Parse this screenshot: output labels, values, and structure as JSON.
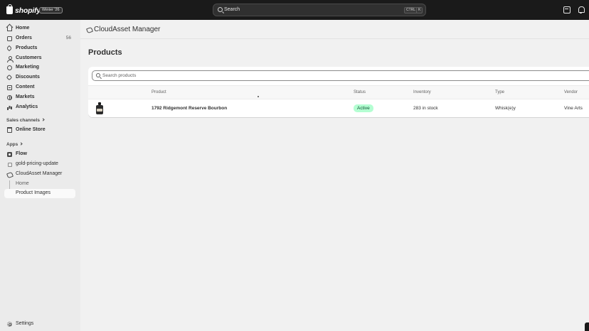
{
  "topbar": {
    "brand": "shopify",
    "edition": "Winter '26",
    "search_placeholder": "Search",
    "shortcut_ctrl": "CTRL",
    "shortcut_key": "K"
  },
  "sidebar": {
    "items": [
      {
        "label": "Home",
        "icon": "home-icon"
      },
      {
        "label": "Orders",
        "icon": "orders-icon",
        "badge": "56"
      },
      {
        "label": "Products",
        "icon": "tag-icon"
      },
      {
        "label": "Customers",
        "icon": "person-icon"
      },
      {
        "label": "Marketing",
        "icon": "target-icon"
      },
      {
        "label": "Discounts",
        "icon": "discount-icon"
      },
      {
        "label": "Content",
        "icon": "content-icon"
      },
      {
        "label": "Markets",
        "icon": "globe-icon"
      },
      {
        "label": "Analytics",
        "icon": "chart-icon"
      }
    ],
    "sales_channels_label": "Sales channels",
    "online_store": "Online Store",
    "apps_label": "Apps",
    "apps": [
      {
        "label": "Flow",
        "icon": "flow-icon"
      },
      {
        "label": "gold-pricing-update",
        "icon": "app-icon"
      },
      {
        "label": "CloudAsset Manager",
        "icon": "cloud-asset-icon"
      }
    ],
    "app_subitems": [
      {
        "label": "Home"
      },
      {
        "label": "Product Images"
      }
    ],
    "settings": "Settings"
  },
  "main": {
    "app_title": "CloudAsset Manager",
    "page_title": "Products",
    "search_placeholder": "Search products",
    "columns": [
      "Product",
      "Status",
      "Inventory",
      "Type",
      "Vendor"
    ],
    "rows": [
      {
        "product": "1792 Ridgemont Reserve Bourbon",
        "status": "Active",
        "inventory": "283 in stock",
        "type": "Whisk(e)y",
        "vendor": "Vine Arts"
      }
    ]
  },
  "colors": {
    "topbar_bg": "#1a1a1a",
    "sidebar_bg": "#ebebeb",
    "status_active_bg": "#b4fed2"
  }
}
